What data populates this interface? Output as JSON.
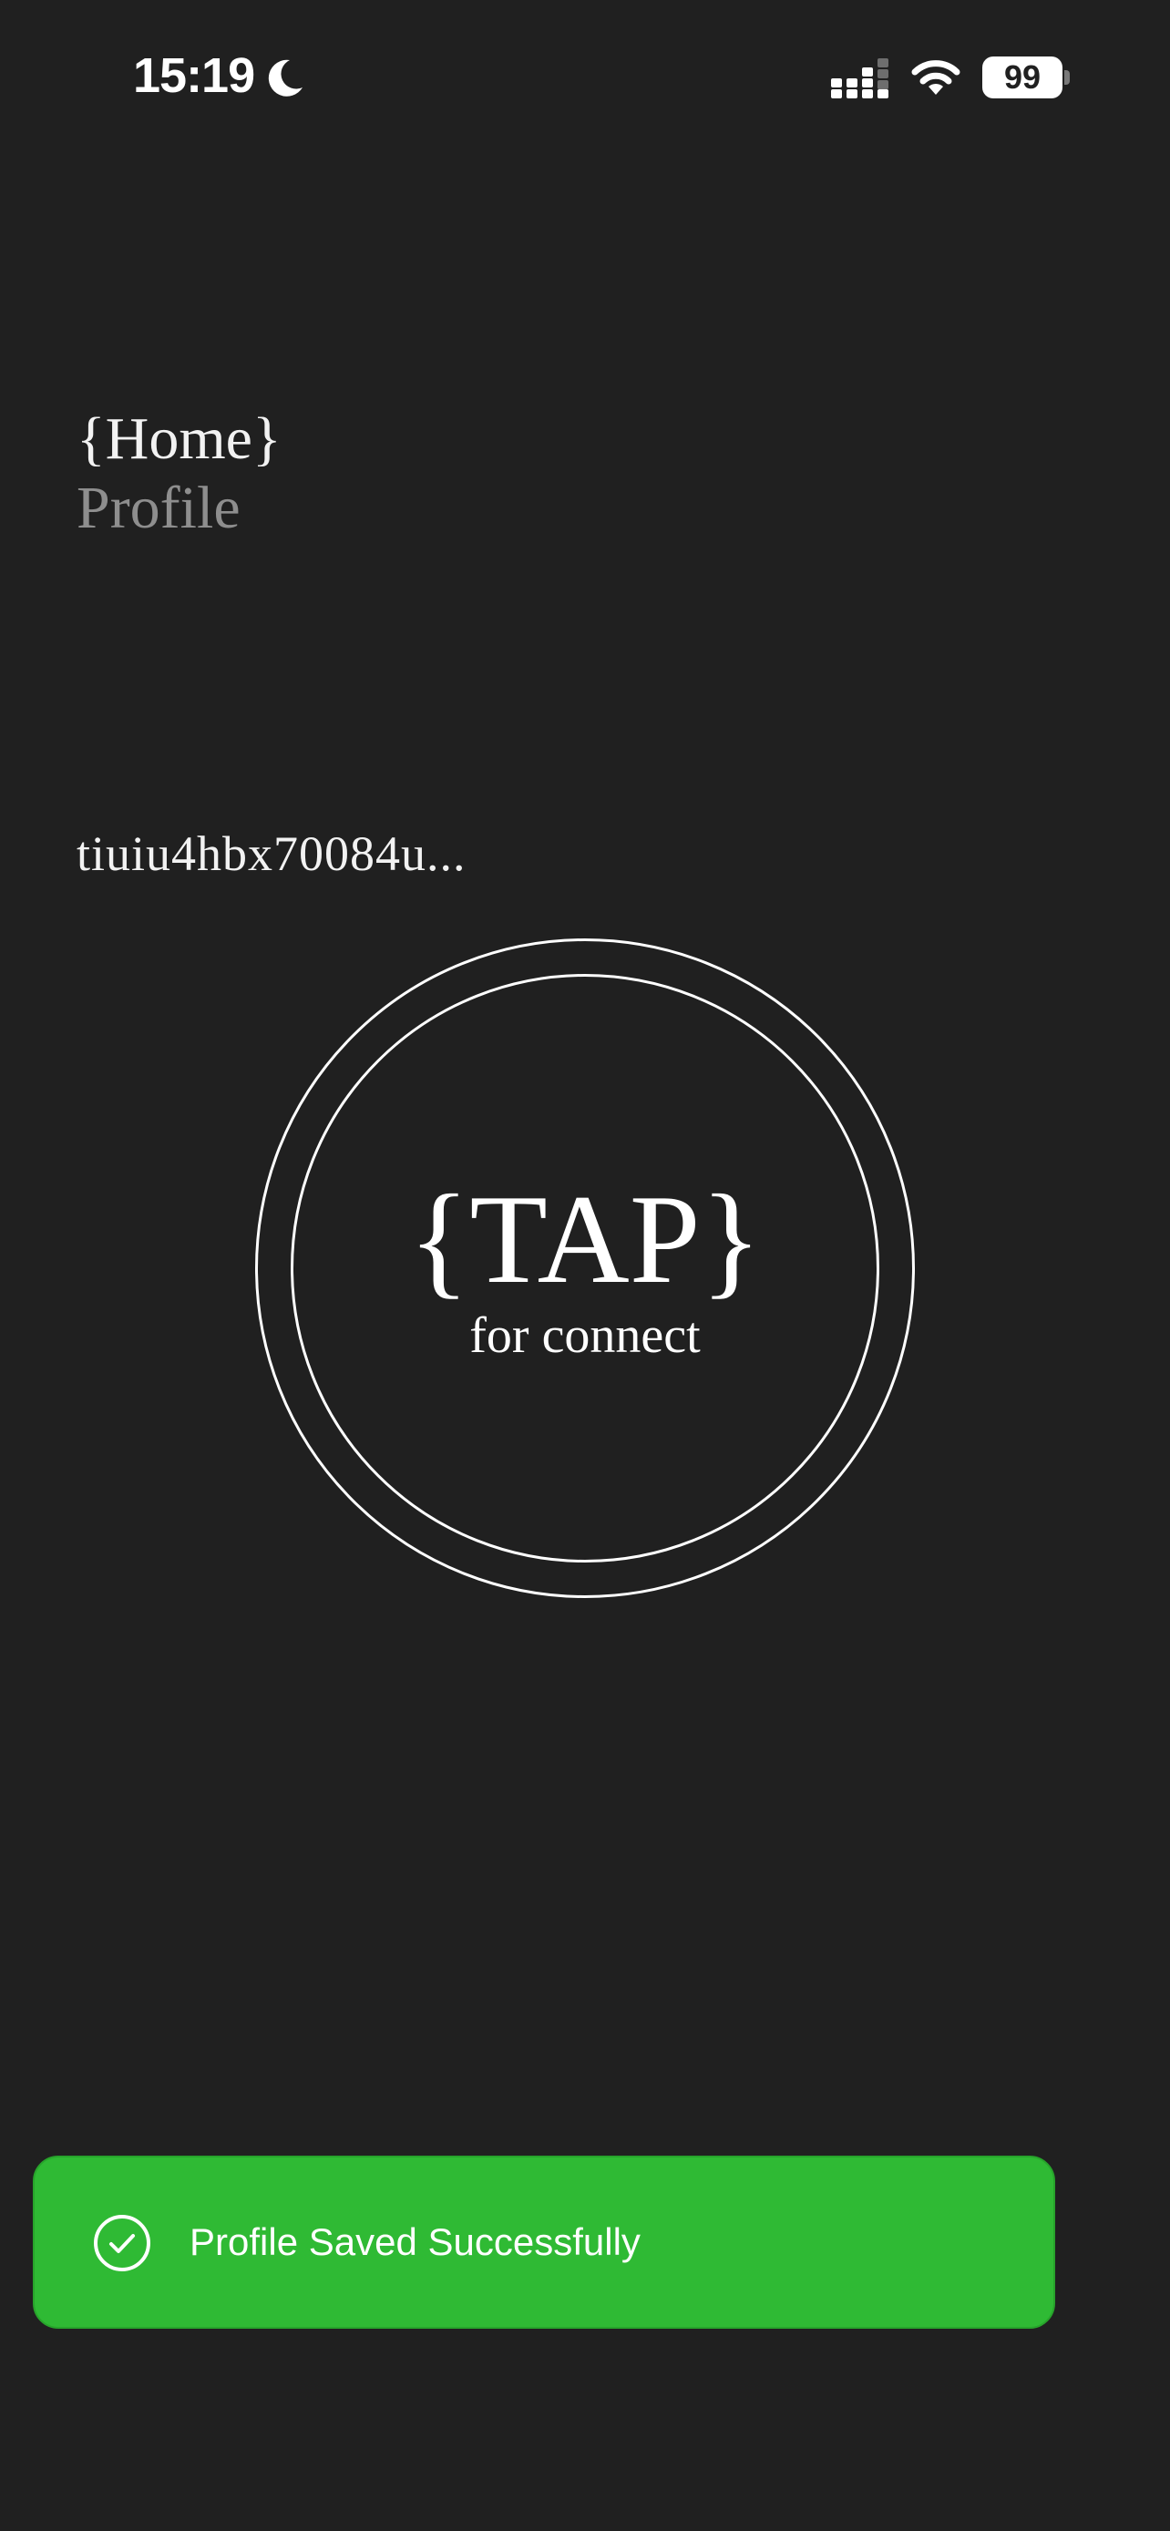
{
  "status_bar": {
    "time": "15:19",
    "battery_level": "99",
    "icons": [
      "moon-icon",
      "signal-icon",
      "wifi-icon",
      "battery-icon"
    ]
  },
  "nav": {
    "home_label": "{Home}",
    "profile_label": "Profile"
  },
  "device": {
    "id_text": "tiuiu4hbx70084u..."
  },
  "tap_button": {
    "title": "{TAP}",
    "subtitle": "for connect"
  },
  "toast": {
    "message": "Profile Saved Successfully",
    "icon": "check-circle-icon",
    "color": "#2fba34"
  },
  "colors": {
    "background": "#202020",
    "text_primary": "#f2f2f2",
    "text_muted": "#8e8e8e",
    "success": "#2fba34"
  }
}
